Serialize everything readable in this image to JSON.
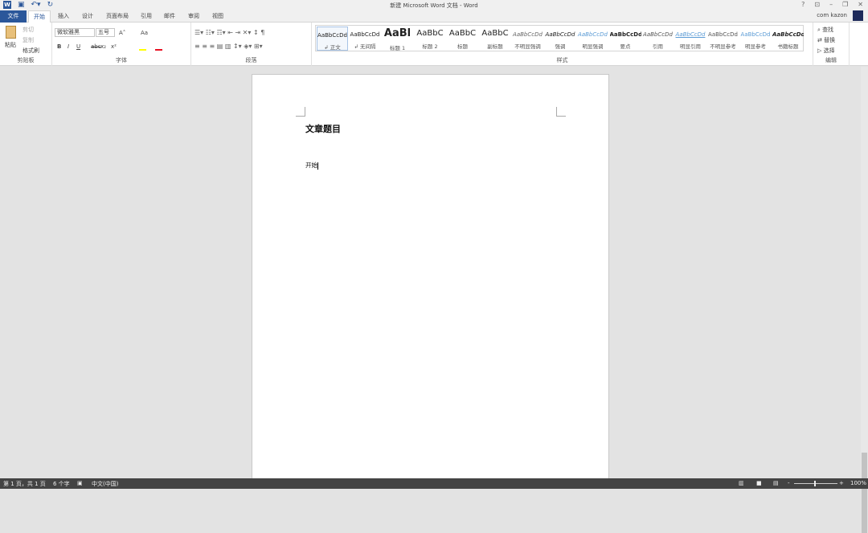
{
  "title": "新建 Microsoft Word 文档 - Word",
  "qat": {
    "logo": "W",
    "save_icon": "save-icon",
    "undo_icon": "undo-icon",
    "redo_icon": "redo-icon"
  },
  "window": {
    "help": "?",
    "ribbon_display": "⊡",
    "minimize": "–",
    "restore": "❐",
    "close": "✕"
  },
  "user": "com kazon",
  "tabs": [
    "文件",
    "开始",
    "插入",
    "设计",
    "页面布局",
    "引用",
    "邮件",
    "审阅",
    "视图"
  ],
  "active_tab": "开始",
  "clipboard": {
    "paste": "粘贴",
    "cut": "剪切",
    "copy": "复制",
    "format_painter": "格式刷",
    "label": "剪贴板"
  },
  "font": {
    "name": "微软雅黑",
    "size": "五号",
    "grow": "A˄",
    "shrink": "A˅",
    "case": "Aa",
    "bold": "B",
    "italic": "I",
    "underline": "U",
    "strike": "abc",
    "sub": "x₂",
    "sup": "x²",
    "label": "字体",
    "font_color": "#e81123",
    "highlight": "#ffff00"
  },
  "paragraph": {
    "label": "段落"
  },
  "styles": {
    "label": "样式",
    "items": [
      {
        "preview": "AaBbCcDd",
        "name": "↲ 正文",
        "selected": true
      },
      {
        "preview": "AaBbCcDd",
        "name": "↲ 无间隔"
      },
      {
        "preview": "AaBl",
        "name": "标题 1"
      },
      {
        "preview": "AaBbC",
        "name": "标题 2"
      },
      {
        "preview": "AaBbC",
        "name": "标题"
      },
      {
        "preview": "AaBbC",
        "name": "副标题"
      },
      {
        "preview": "AaBbCcDd",
        "name": "不明显强调"
      },
      {
        "preview": "AaBbCcDd",
        "name": "强调"
      },
      {
        "preview": "AaBbCcDd",
        "name": "明显强调"
      },
      {
        "preview": "AaBbCcDd",
        "name": "要点"
      },
      {
        "preview": "AaBbCcDd",
        "name": "引用"
      },
      {
        "preview": "AaBbCcDd",
        "name": "明显引用"
      },
      {
        "preview": "AaBbCcDd",
        "name": "不明显参考"
      },
      {
        "preview": "AaBbCcDd",
        "name": "明显参考"
      },
      {
        "preview": "AaBbCcDd",
        "name": "书籍标题"
      }
    ]
  },
  "editing": {
    "find": "查找",
    "replace": "替换",
    "select": "选择",
    "label": "编辑"
  },
  "document": {
    "heading": "文章题目",
    "body": "开始"
  },
  "status": {
    "page": "第 1 页，共 1 页",
    "words": "6 个字",
    "language": "中文(中国)",
    "zoom": "100%",
    "zoom_minus": "-",
    "zoom_plus": "+"
  }
}
